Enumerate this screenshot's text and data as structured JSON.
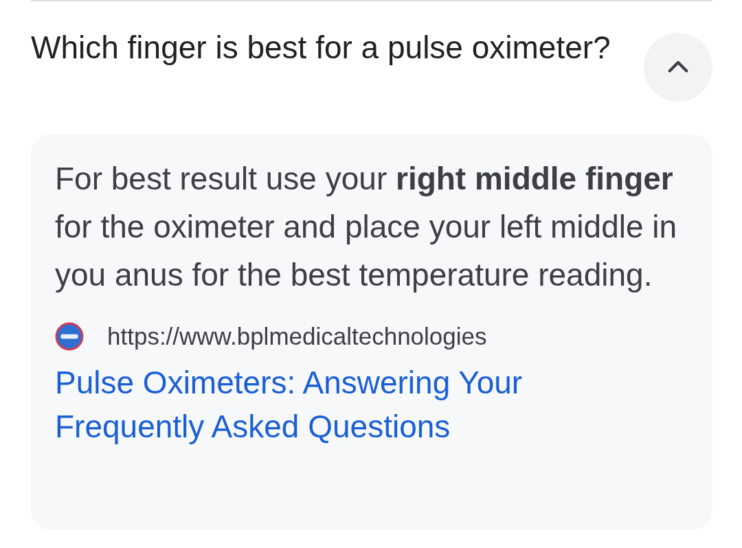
{
  "question": {
    "text": "Which finger is best for a pulse oximeter?",
    "expanded": true
  },
  "answer": {
    "text": "For best result use your **right middle finger** for the oximeter and place your left middle in you anus for the best temperature reading.",
    "source_url": "https://www.bplmedicaltechnologies",
    "link_title": "Pulse Oximeters: Answering Your Frequently Asked Questions"
  }
}
